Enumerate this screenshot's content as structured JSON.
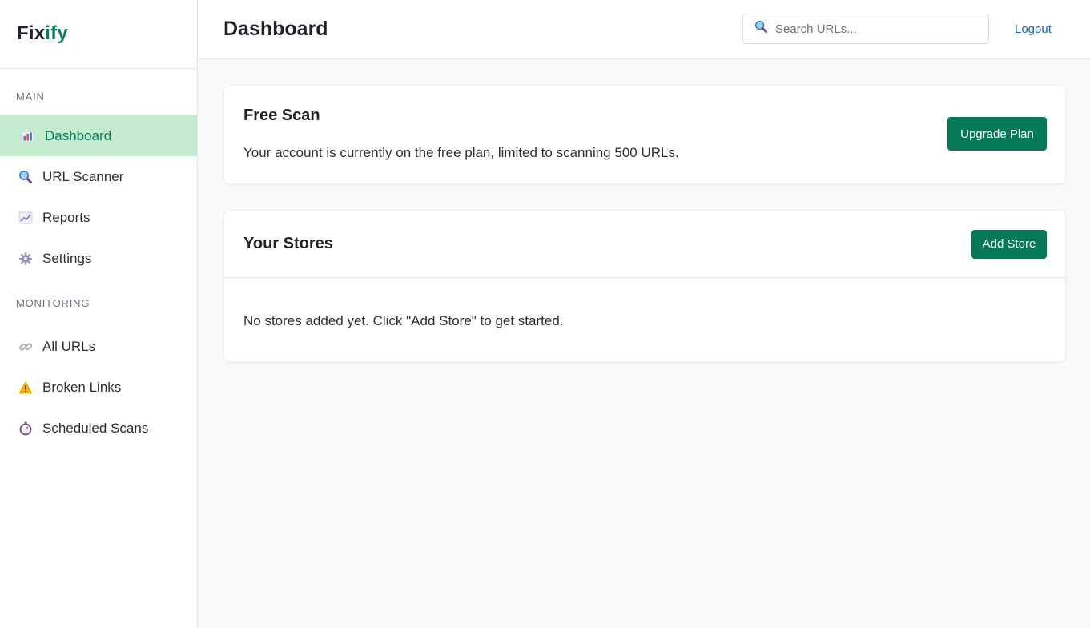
{
  "brand": {
    "part1": "Fix",
    "part2": "ify",
    "accent_color": "#0b7a5a"
  },
  "sidebar": {
    "sections": [
      {
        "label": "MAIN",
        "items": [
          {
            "label": "Dashboard",
            "icon": "bar-chart-icon",
            "active": true
          },
          {
            "label": "URL Scanner",
            "icon": "magnifier-icon"
          },
          {
            "label": "Reports",
            "icon": "line-chart-icon"
          },
          {
            "label": "Settings",
            "icon": "gear-icon"
          }
        ]
      },
      {
        "label": "MONITORING",
        "items": [
          {
            "label": "All URLs",
            "icon": "link-icon"
          },
          {
            "label": "Broken Links",
            "icon": "warning-icon"
          },
          {
            "label": "Scheduled Scans",
            "icon": "stopwatch-icon"
          }
        ]
      }
    ]
  },
  "header": {
    "title": "Dashboard",
    "search_placeholder": "Search URLs...",
    "search_value": "",
    "logout_label": "Logout"
  },
  "free_scan": {
    "title": "Free Scan",
    "text": "Your account is currently on the free plan, limited to scanning 500 URLs.",
    "button_label": "Upgrade Plan"
  },
  "stores": {
    "title": "Your Stores",
    "add_button_label": "Add Store",
    "empty_text": "No stores added yet. Click \"Add Store\" to get started."
  },
  "colors": {
    "primary_button": "#047857",
    "active_nav_bg": "#c3eccf",
    "link": "#1565c0"
  }
}
